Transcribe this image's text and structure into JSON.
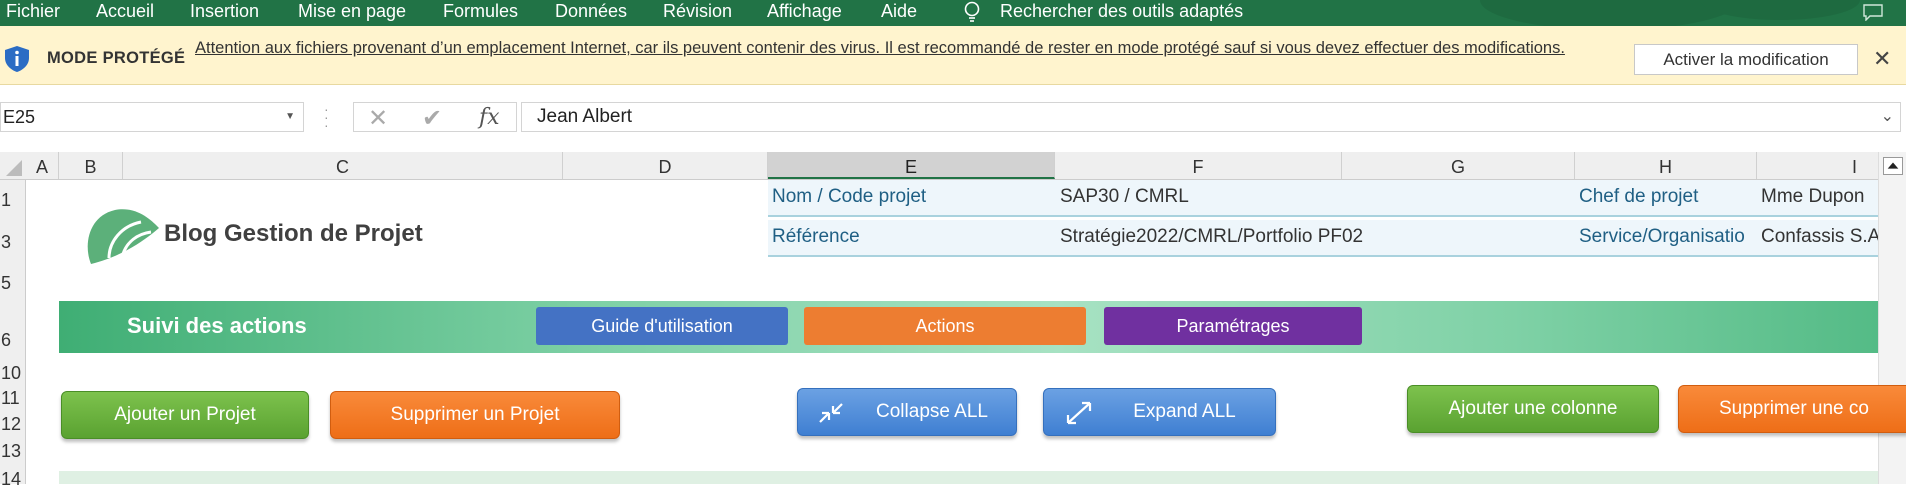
{
  "ribbon": {
    "tabs": [
      "Fichier",
      "Accueil",
      "Insertion",
      "Mise en page",
      "Formules",
      "Données",
      "Révision",
      "Affichage",
      "Aide"
    ],
    "search_label": "Rechercher des outils adaptés",
    "color": "#217346"
  },
  "protected_bar": {
    "title": "MODE PROTÉGÉ",
    "message": "Attention aux fichiers provenant d’un emplacement Internet, car ils peuvent contenir des virus. Il est recommandé de rester en mode protégé sauf si vous devez effectuer des modifications.",
    "enable_button": "Activer la modification",
    "close_label": "✕"
  },
  "formula_bar": {
    "name_box": "E25",
    "formula": "Jean Albert",
    "cancel": "✕",
    "enter": "✔",
    "fx": "fx"
  },
  "columns": [
    "A",
    "B",
    "C",
    "D",
    "E",
    "F",
    "G",
    "H",
    "I"
  ],
  "selected_column": "E",
  "rows": [
    "1",
    "3",
    "5",
    "6",
    "10",
    "11",
    "12",
    "13",
    "14"
  ],
  "header_info": {
    "logo_text": "Blog Gestion de Projet",
    "project_label": "Nom / Code projet",
    "project_value": "SAP30 / CMRL",
    "reference_label": "Référence",
    "reference_value": "Stratégie2022/CMRL/Portfolio PF02",
    "manager_label": "Chef de projet",
    "manager_value": "Mme Dupon",
    "service_label": "Service/Organisatio",
    "service_value": "Confassis S.A"
  },
  "banner": {
    "title": "Suivi des actions",
    "nav": [
      "Guide d'utilisation",
      "Actions",
      "Paramétrages"
    ]
  },
  "actions": {
    "add_project": "Ajouter un Projet",
    "remove_project": "Supprimer un Projet",
    "collapse_all": "Collapse ALL",
    "expand_all": "Expand ALL",
    "add_column": "Ajouter une colonne",
    "remove_column": "Supprimer une co"
  }
}
